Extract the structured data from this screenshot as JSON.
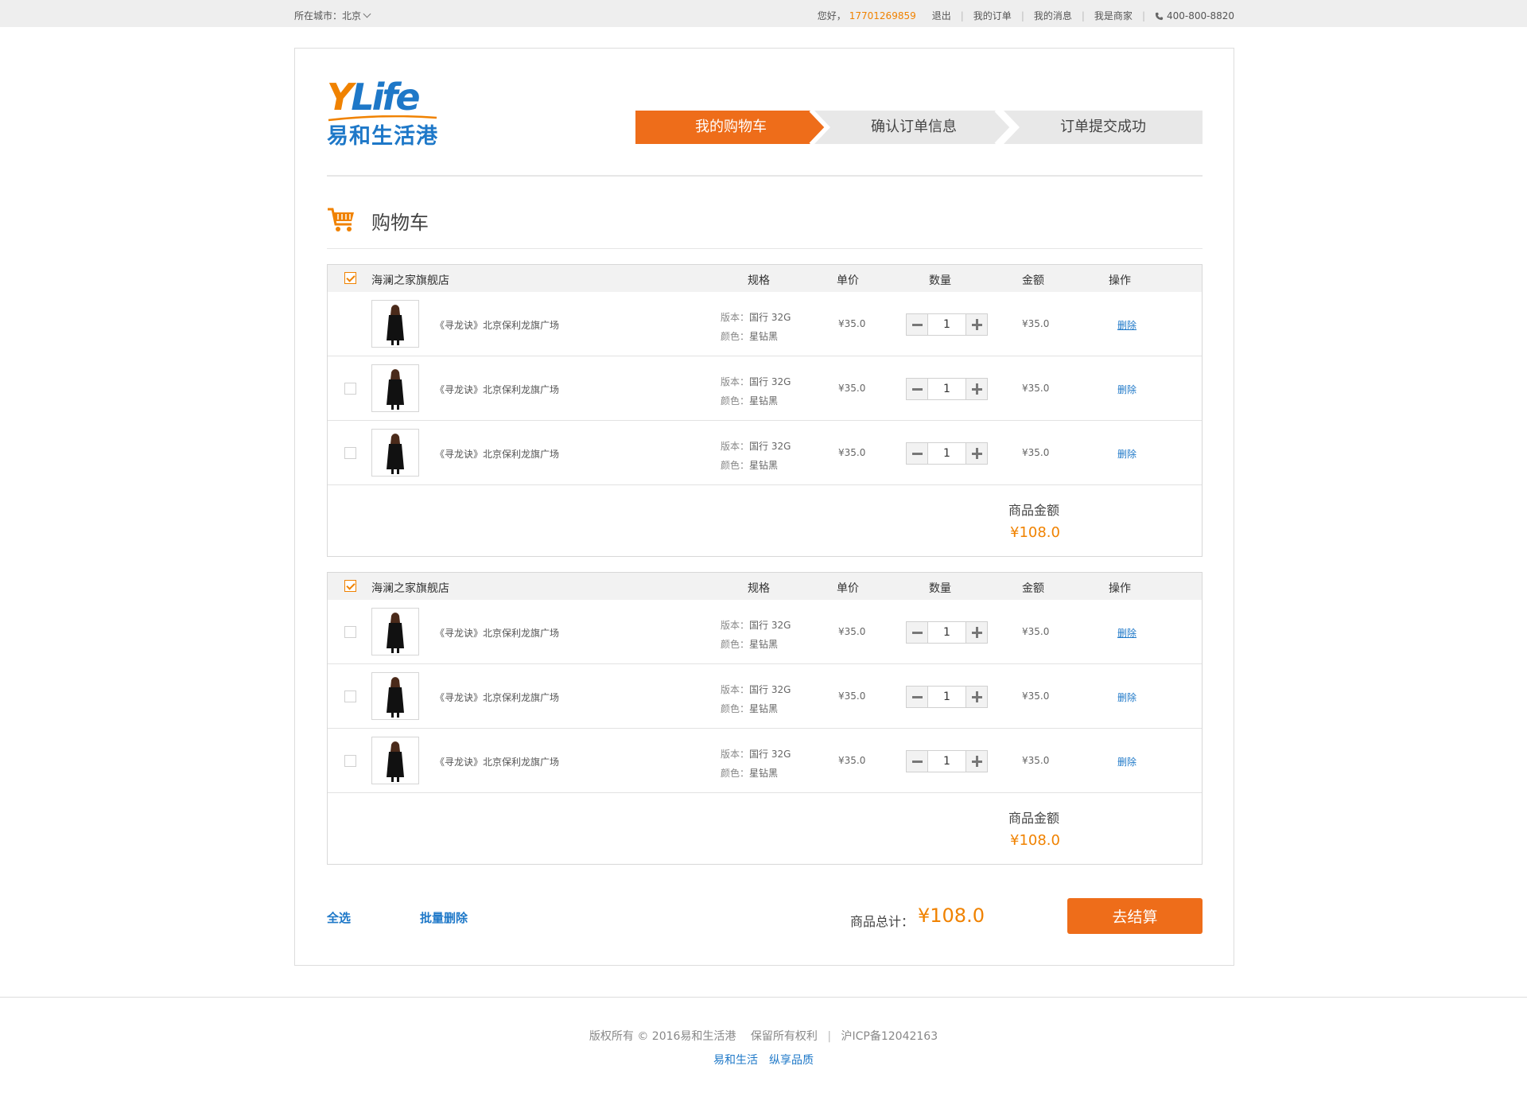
{
  "topbar": {
    "city_label": "所在城市：",
    "city_value": "北京",
    "greeting": "您好，",
    "phone": "17701269859",
    "logout": "退出",
    "my_orders": "我的订单",
    "my_messages": "我的消息",
    "merchant": "我是商家",
    "hotline": "400-800-8820"
  },
  "logo": {
    "text_y": "Y",
    "text_life": "Life",
    "text_cn": "易和生活港"
  },
  "steps": [
    "我的购物车",
    "确认订单信息",
    "订单提交成功"
  ],
  "cart": {
    "title": "购物车",
    "columns": {
      "spec": "规格",
      "unit_price": "单价",
      "quantity": "数量",
      "amount": "金额",
      "action": "操作"
    },
    "shops": [
      {
        "name": "海澜之家旗舰店",
        "checked": true,
        "items": [
          {
            "name": "《寻龙诀》北京保利龙旗广场",
            "version_label": "版本：",
            "version": "国行 32G",
            "color_label": "颜色：",
            "color": "星钻黑",
            "price": "¥35.0",
            "qty": "1",
            "amount": "¥35.0",
            "delete": "删除",
            "checked": false
          },
          {
            "name": "《寻龙诀》北京保利龙旗广场",
            "version_label": "版本：",
            "version": "国行 32G",
            "color_label": "颜色：",
            "color": "星钻黑",
            "price": "¥35.0",
            "qty": "1",
            "amount": "¥35.0",
            "delete": "删除",
            "checked": false
          },
          {
            "name": "《寻龙诀》北京保利龙旗广场",
            "version_label": "版本：",
            "version": "国行 32G",
            "color_label": "颜色：",
            "color": "星钻黑",
            "price": "¥35.0",
            "qty": "1",
            "amount": "¥35.0",
            "delete": "删除",
            "checked": false
          }
        ],
        "subtotal_label": "商品金额",
        "subtotal": "¥108.0"
      },
      {
        "name": "海澜之家旗舰店",
        "checked": true,
        "items": [
          {
            "name": "《寻龙诀》北京保利龙旗广场",
            "version_label": "版本：",
            "version": "国行 32G",
            "color_label": "颜色：",
            "color": "星钻黑",
            "price": "¥35.0",
            "qty": "1",
            "amount": "¥35.0",
            "delete": "删除",
            "checked": false
          },
          {
            "name": "《寻龙诀》北京保利龙旗广场",
            "version_label": "版本：",
            "version": "国行 32G",
            "color_label": "颜色：",
            "color": "星钻黑",
            "price": "¥35.0",
            "qty": "1",
            "amount": "¥35.0",
            "delete": "删除",
            "checked": false
          },
          {
            "name": "《寻龙诀》北京保利龙旗广场",
            "version_label": "版本：",
            "version": "国行 32G",
            "color_label": "颜色：",
            "color": "星钻黑",
            "price": "¥35.0",
            "qty": "1",
            "amount": "¥35.0",
            "delete": "删除",
            "checked": false
          }
        ],
        "subtotal_label": "商品金额",
        "subtotal": "¥108.0"
      }
    ]
  },
  "bottom": {
    "select_all": "全选",
    "batch_delete": "批量删除",
    "total_label": "商品总计：",
    "total_value": "¥108.0",
    "checkout": "去结算"
  },
  "footer": {
    "copyright": "版权所有 © 2016易和生活港",
    "rights": "保留所有权利",
    "icp": "沪ICP备12042163",
    "slogan_1": "易和生活",
    "slogan_2": "纵享品质"
  },
  "colors": {
    "accent": "#ee6d1a",
    "brand_orange": "#f08200",
    "brand_blue": "#1e78c8",
    "step_inactive": "#e8e8e8"
  },
  "icons": [
    "chevron-down-icon",
    "phone-icon",
    "cart-icon",
    "checkbox-icon",
    "minus-icon",
    "plus-icon",
    "product-thumbnail"
  ]
}
